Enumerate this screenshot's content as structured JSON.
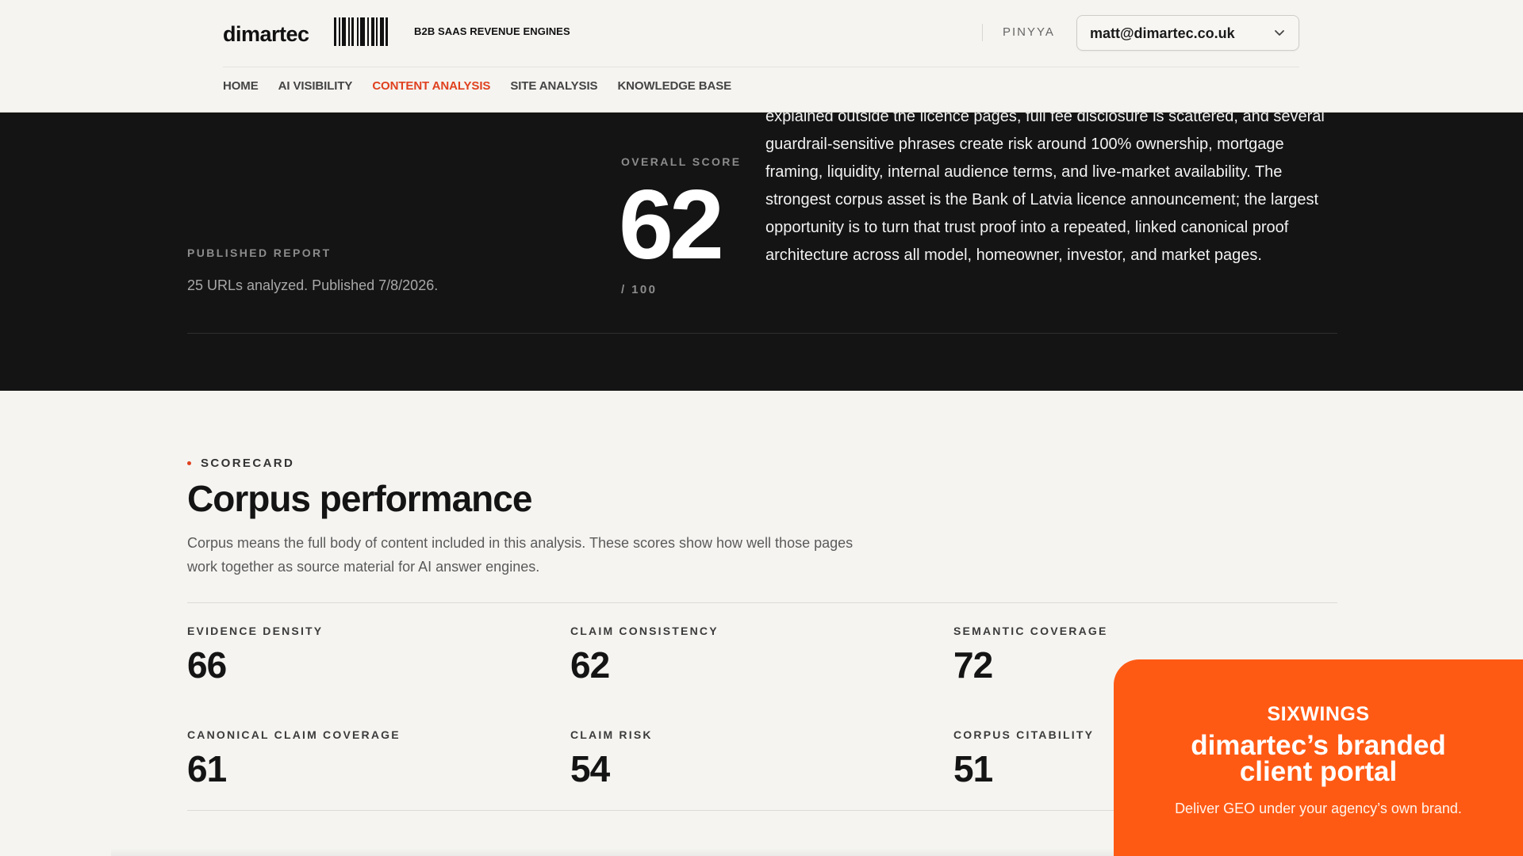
{
  "header": {
    "logo": "dimartec",
    "tagline": "B2B SAAS REVENUE ENGINES",
    "org": "PINYYA",
    "account_email": "matt@dimartec.co.uk",
    "nav": [
      {
        "label": "HOME",
        "active": false
      },
      {
        "label": "AI VISIBILITY",
        "active": false
      },
      {
        "label": "CONTENT ANALYSIS",
        "active": true
      },
      {
        "label": "SITE ANALYSIS",
        "active": false
      },
      {
        "label": "KNOWLEDGE BASE",
        "active": false
      }
    ]
  },
  "hero": {
    "published_label": "PUBLISHED REPORT",
    "published_text": "25 URLs analyzed. Published 7/8/2026.",
    "score_label": "OVERALL SCORE",
    "score": "62",
    "score_out_of": "/ 100",
    "summary": "explained outside the licence pages, full fee disclosure is scattered, and several guardrail-sensitive phrases create risk around 100% ownership, mortgage framing, liquidity, internal audience terms, and live-market availability. The strongest corpus asset is the Bank of Latvia licence announcement; the largest opportunity is to turn that trust proof into a repeated, linked canonical proof architecture across all model, homeowner, investor, and market pages."
  },
  "scorecard": {
    "eyebrow": "SCORECARD",
    "title": "Corpus performance",
    "description": "Corpus means the full body of content included in this analysis. These scores show how well those pages work together as source material for AI answer engines.",
    "metrics": [
      {
        "label": "EVIDENCE DENSITY",
        "value": "66"
      },
      {
        "label": "CLAIM CONSISTENCY",
        "value": "62"
      },
      {
        "label": "SEMANTIC COVERAGE",
        "value": "72"
      },
      {
        "label": "CANONICAL CLAIM COVERAGE",
        "value": "61"
      },
      {
        "label": "CLAIM RISK",
        "value": "54"
      },
      {
        "label": "CORPUS CITABILITY",
        "value": "51"
      }
    ]
  },
  "promo": {
    "brand": "SIXWINGS",
    "headline_line1": "dimartec’s branded",
    "headline_line2": "client portal",
    "subtext": "Deliver GEO under your agency’s own brand."
  },
  "colors": {
    "accent": "#e0401e",
    "hero_bg": "#141414",
    "page_bg": "#f5f4f1",
    "promo_bg": "#ff5a14"
  }
}
